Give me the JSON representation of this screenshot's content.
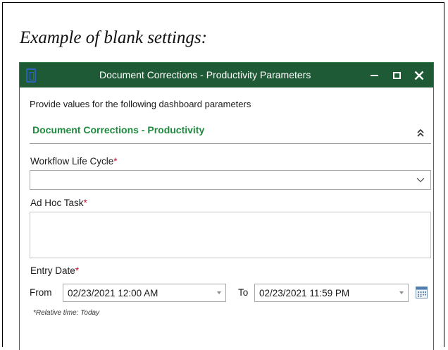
{
  "caption": "Example of blank settings:",
  "window": {
    "title": "Document Corrections - Productivity Parameters",
    "controls": {
      "minimize": "minimize",
      "maximize": "maximize",
      "close": "close"
    }
  },
  "intro_text": "Provide values for the following dashboard parameters",
  "section": {
    "title": "Document Corrections - Productivity"
  },
  "fields": {
    "workflow_life_cycle": {
      "label": "Workflow Life Cycle",
      "required_mark": "*",
      "value": ""
    },
    "ad_hoc_task": {
      "label": "Ad Hoc Task",
      "required_mark": "*",
      "value": ""
    },
    "entry_date": {
      "label": "Entry Date",
      "required_mark": "*",
      "from_label": "From",
      "from_value": "02/23/2021 12:00 AM",
      "to_label": "To",
      "to_value": "02/23/2021 11:59 PM",
      "relative_note": "*Relative time: Today"
    }
  },
  "colors": {
    "titlebar": "#1f5a36",
    "section_title": "#1f8a3f",
    "required": "#c8102e",
    "window_border": "#2f7a4b"
  },
  "icons": {
    "app": "app-icon",
    "minimize": "minimize-icon",
    "maximize": "maximize-icon",
    "close": "close-icon",
    "collapse": "collapse-chevrons-icon",
    "dropdown": "chevron-down-icon",
    "calendar": "calendar-icon"
  }
}
